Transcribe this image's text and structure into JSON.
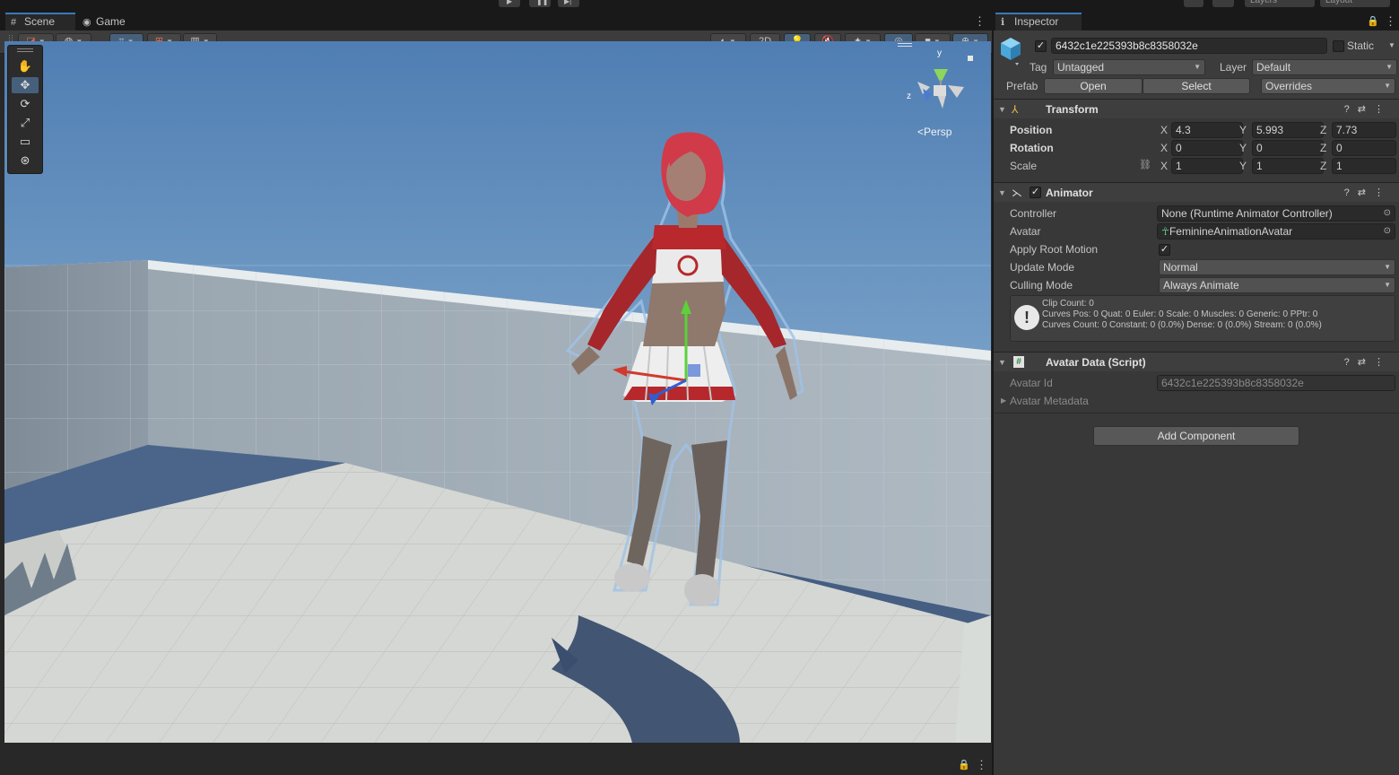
{
  "scene_window": {
    "tabs": [
      {
        "label": "Scene",
        "icon": "hash-icon",
        "active": true
      },
      {
        "label": "Game",
        "icon": "gamepad-icon",
        "active": false
      }
    ],
    "toolbar": {
      "mode_2d": "2D"
    },
    "gizmo": {
      "axis_y": "y",
      "axis_z": "z",
      "projection": "Persp"
    },
    "tools": [
      "hand-tool",
      "move-tool",
      "rotate-tool",
      "scale-tool",
      "rect-tool",
      "transform-tool"
    ],
    "active_tool": "move-tool"
  },
  "inspector": {
    "tab": "Inspector",
    "object": {
      "active": true,
      "name": "6432c1e225393b8c8358032e",
      "static_label": "Static",
      "tag_label": "Tag",
      "tag": "Untagged",
      "layer_label": "Layer",
      "layer": "Default",
      "prefab_label": "Prefab",
      "open_label": "Open",
      "select_label": "Select",
      "overrides_label": "Overrides"
    },
    "transform": {
      "title": "Transform",
      "position_label": "Position",
      "rotation_label": "Rotation",
      "scale_label": "Scale",
      "position": {
        "x": "4.3",
        "y": "5.993",
        "z": "7.73"
      },
      "rotation": {
        "x": "0",
        "y": "0",
        "z": "0"
      },
      "scale": {
        "x": "1",
        "y": "1",
        "z": "1"
      }
    },
    "animator": {
      "title": "Animator",
      "enabled": true,
      "controller_label": "Controller",
      "controller": "None (Runtime Animator Controller)",
      "avatar_label": "Avatar",
      "avatar": "FeminineAnimationAvatar",
      "apply_root_motion_label": "Apply Root Motion",
      "apply_root_motion": true,
      "update_mode_label": "Update Mode",
      "update_mode": "Normal",
      "culling_mode_label": "Culling Mode",
      "culling_mode": "Always Animate",
      "info_line1": "Clip Count: 0",
      "info_line2": "Curves Pos: 0 Quat: 0 Euler: 0 Scale: 0 Muscles: 0 Generic: 0 PPtr: 0",
      "info_line3": "Curves Count: 0 Constant: 0 (0.0%) Dense: 0 (0.0%) Stream: 0 (0.0%)"
    },
    "avatar_data": {
      "title": "Avatar Data (Script)",
      "avatar_id_label": "Avatar Id",
      "avatar_id": "6432c1e225393b8c8358032e",
      "avatar_metadata_label": "Avatar Metadata"
    },
    "add_component_label": "Add Component"
  },
  "top_bar": {
    "layers_label": "Layers",
    "layout_label": "Layout"
  },
  "colors": {
    "accent": "#3a79bb",
    "panel": "#383838",
    "sky": "#5b86b6",
    "floor": "#d7d9d6"
  }
}
